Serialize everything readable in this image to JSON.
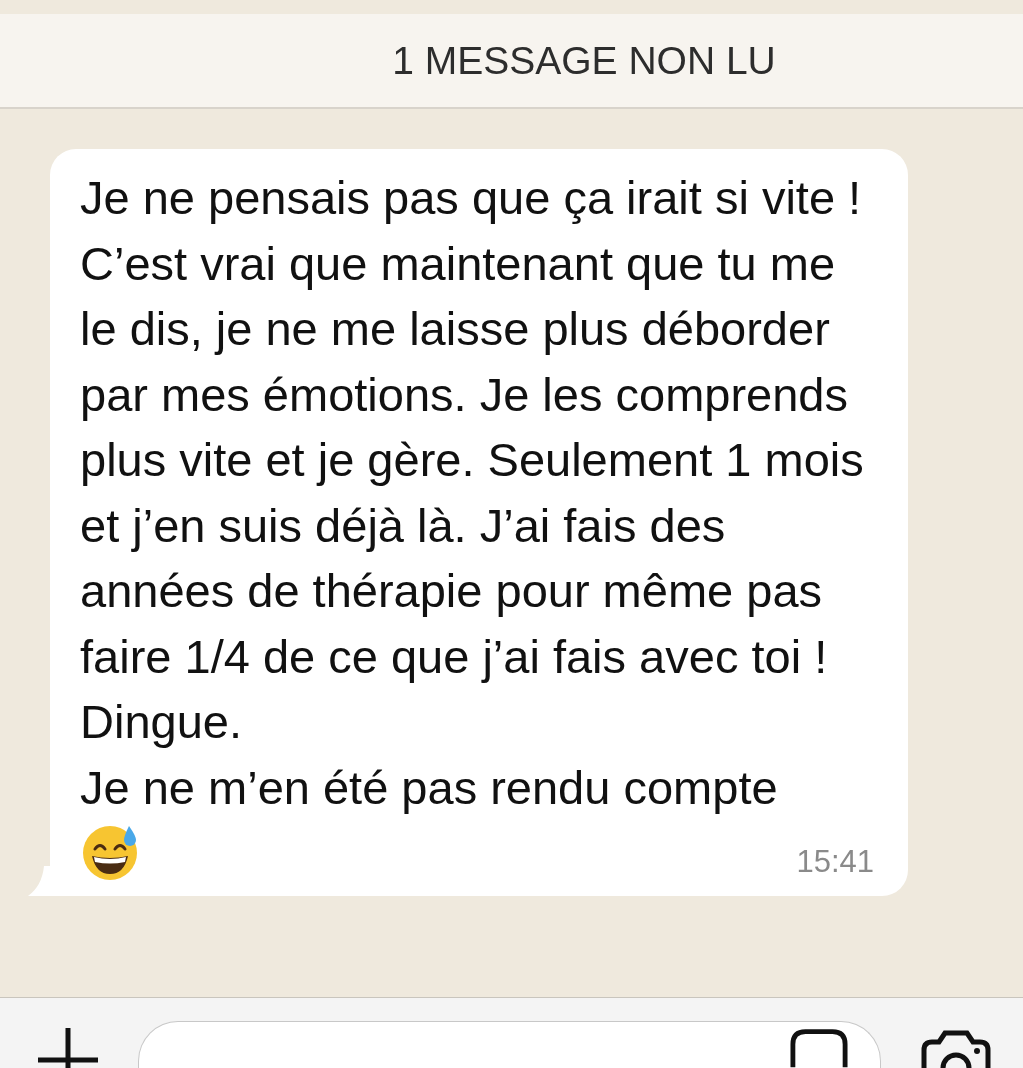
{
  "unread_banner": "1 MESSAGE NON LU",
  "message": {
    "paragraphs": [
      "Je ne pensais pas que ça irait si vite !",
      "C’est vrai que maintenant que tu me le dis, je ne me laisse plus déborder par mes émotions. Je les comprends plus vite et je gère. Seulement 1 mois et j’en suis déjà là. J’ai fais des années de thérapie pour même pas faire 1/4 de ce que j’ai fais avec toi ! Dingue.",
      "Je ne m’en été pas rendu compte"
    ],
    "time": "15:41"
  }
}
